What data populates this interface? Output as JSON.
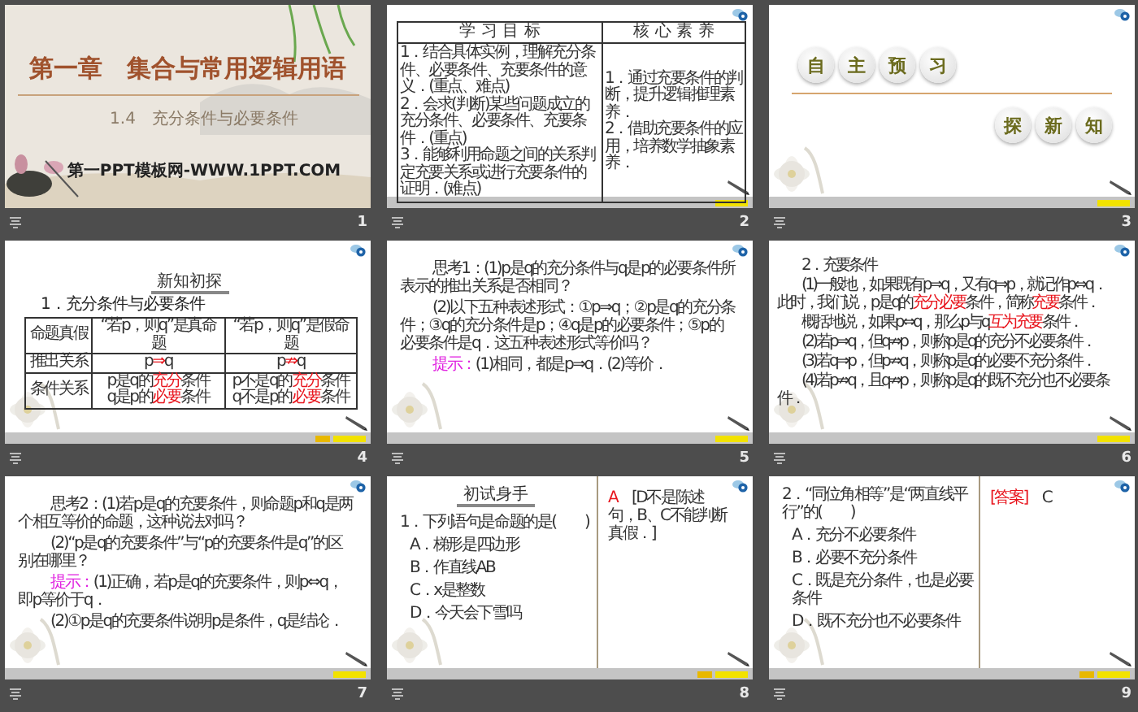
{
  "slides": [
    {
      "number": "1",
      "kind": "title",
      "title": "第一章　集合与常用逻辑用语",
      "subtitle": "1.4　充分条件与必要条件",
      "site": "第一PPT模板网-WWW.1PPT.COM"
    },
    {
      "number": "2",
      "kind": "objectives",
      "columns": [
        {
          "heading": "学 习 目 标",
          "items": [
            "1．结合具体实例，理解充分条件、必要条件、充要条件的意义．(重点、难点)",
            "2．会求(判断)某些问题成立的充分条件、必要条件、充要条件．(重点)",
            "3．能够利用命题之间的关系判定充要关系或进行充要条件的证明．(难点)"
          ]
        },
        {
          "heading": "核 心 素 养",
          "items": [
            "1．通过充要条件的判断，提升逻辑推理素养．",
            "2．借助充要条件的应用，培养数学抽象素养．"
          ]
        }
      ]
    },
    {
      "number": "3",
      "kind": "section",
      "rows": [
        [
          "自",
          "主",
          "预",
          "习"
        ],
        [
          "探",
          "新",
          "知"
        ]
      ]
    },
    {
      "number": "4",
      "kind": "knowledge",
      "badge": "新知初探",
      "heading": "1．充分条件与必要条件",
      "rows": [
        [
          [
            "命题真假"
          ],
          [
            "“若p，则q”是真命题"
          ],
          [
            "“若p，则q”是假命题"
          ]
        ],
        [
          [
            "推出关系"
          ],
          [
            [
              "p",
              {
                "text": "⇒",
                "kind": "red"
              },
              "q"
            ]
          ],
          [
            [
              "p",
              {
                "text": "⇏",
                "kind": "red"
              },
              "q"
            ]
          ]
        ],
        [
          [
            "条件关系"
          ],
          [
            [
              "p是q的",
              {
                "text": "充分",
                "kind": "red"
              },
              "条件"
            ],
            [
              "q是p的",
              {
                "text": "必要",
                "kind": "red"
              },
              "条件"
            ]
          ],
          [
            [
              "p不是q的",
              {
                "text": "充分",
                "kind": "red"
              },
              "条件"
            ],
            [
              "q不是p的",
              {
                "text": "必要",
                "kind": "red"
              },
              "条件"
            ]
          ]
        ]
      ]
    },
    {
      "number": "5",
      "kind": "text",
      "paragraphs": [
        "思考1：(1)p是q的充分条件与q是p的必要条件所表示的推出关系是否相同？",
        "(2)以下五种表述形式：①p⇒q；②p是q的充分条件；③q的充分条件是p；④q是p的必要条件；⑤p的必要条件是q．这五种表述形式等价吗？",
        [
          {
            "text": "提示：",
            "kind": "pink"
          },
          "(1)相同，都是p⇒q．(2)等价．"
        ]
      ]
    },
    {
      "number": "6",
      "kind": "text",
      "paragraphs": [
        "2．充要条件",
        [
          "(1)一般地，如果既有p⇒q，又有q⇒p，就记作p⇔q．此时，我们说，p是q的",
          {
            "text": "充分必要",
            "kind": "red"
          },
          "条件，简称",
          {
            "text": "充要",
            "kind": "red"
          },
          "条件．"
        ],
        [
          "概括地说，如果p⇔q，那么p与q",
          {
            "text": "互为充要",
            "kind": "red"
          },
          "条件．"
        ],
        "(2)若p⇒q，但q⇏p，则称p是q的充分不必要条件．",
        "(3)若q⇒p，但p⇏q，则称p是q的必要不充分条件．",
        "(4)若p⇏q，且q⇏p，则称p是q的既不充分也不必要条件．"
      ]
    },
    {
      "number": "7",
      "kind": "text",
      "paragraphs": [
        "思考2：(1)若p是q的充要条件，则命题p和q是两个相互等价的命题，这种说法对吗？",
        "(2)“p是q的充要条件”与“p的充要条件是q”的区别在哪里？",
        [
          {
            "text": "提示：",
            "kind": "pink"
          },
          "(1)正确，若p是q的充要条件，则p⇔q，即p等价于q．"
        ],
        "(2)①p是q的充要条件说明p是条件，q是结论．"
      ]
    },
    {
      "number": "8",
      "kind": "quiz",
      "badge": "初试身手",
      "question": "1．下列语句是命题的是(　　)",
      "options": [
        "A．梯形是四边形",
        "B．作直线AB",
        "C．x是整数",
        "D．今天会下雪吗"
      ],
      "answer": [
        {
          "text": "A",
          "kind": "red"
        },
        "　[D不是陈述句，B、C不能判断真假．]"
      ]
    },
    {
      "number": "9",
      "kind": "quiz",
      "question": "2．“同位角相等”是“两直线平行”的(　　)",
      "options": [
        "A．充分不必要条件",
        "B．必要不充分条件",
        "C．既是充分条件，也是必要条件",
        "D．既不充分也不必要条件"
      ],
      "answer": [
        {
          "text": "[答案]",
          "kind": "red"
        },
        "　C"
      ]
    }
  ]
}
